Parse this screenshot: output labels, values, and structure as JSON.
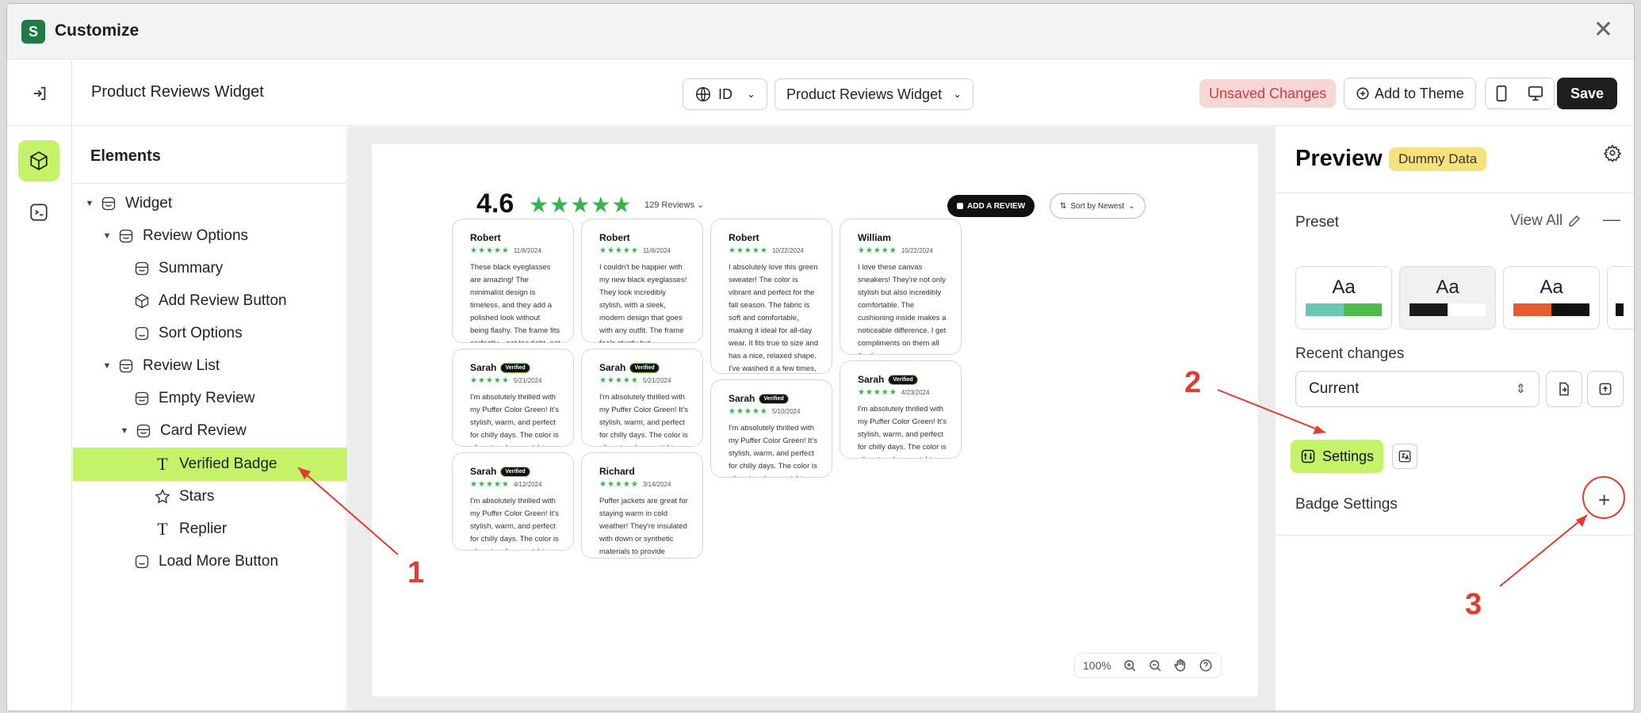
{
  "window": {
    "title": "Customize",
    "close_label": "✕"
  },
  "topbar": {
    "widget_name": "Product Reviews Widget",
    "language": "ID",
    "widget_select": "Product Reviews Widget",
    "unsaved": "Unsaved Changes",
    "add_to_theme": "Add to Theme",
    "save": "Save"
  },
  "elements_panel": {
    "title": "Elements",
    "items": [
      {
        "label": "Widget"
      },
      {
        "label": "Review Options"
      },
      {
        "label": "Summary"
      },
      {
        "label": "Add Review Button"
      },
      {
        "label": "Sort Options"
      },
      {
        "label": "Review List"
      },
      {
        "label": "Empty Review"
      },
      {
        "label": "Card Review"
      },
      {
        "label": "Verified Badge"
      },
      {
        "label": "Stars"
      },
      {
        "label": "Replier"
      },
      {
        "label": "Load More Button"
      }
    ]
  },
  "preview_widget": {
    "rating": "4.6",
    "stars": "★★★★★",
    "review_count": "129 Reviews",
    "add_review": "ADD A REVIEW",
    "sort": "Sort by Newest",
    "stars_small": "★★★★★",
    "verified": "Verified",
    "cards": [
      {
        "name": "Robert",
        "date": "11/8/2024",
        "text": "These black eyeglasses are amazing! The minimalist design is timeless, and they add a polished look without being flashy. The frame fits perfectly—not too tight, not too loose—and they're super comfortable, even after wearing them for hours. The qual..."
      },
      {
        "name": "Sarah",
        "date": "5/21/2024",
        "text": "I'm absolutely thrilled with my Puffer Color Green! It's stylish, warm, and perfect for chilly days. The color is vibrant and eye-catching. Highly recommend!"
      },
      {
        "name": "Sarah",
        "date": "4/12/2024",
        "text": "I'm absolutely thrilled with my Puffer Color Green! It's stylish, warm, and perfect for chilly days. The color is vibrant and eye-catching. Highly recommend!"
      },
      {
        "name": "Robert",
        "date": "11/8/2024",
        "text": "I couldn't be happier with my new black eyeglasses! They look incredibly stylish, with a sleek, modern design that goes with any outfit. The frame feels sturdy but lightweight, so they're comfortable to wear all day. The lenses offer clear vision wit..."
      },
      {
        "name": "Sarah",
        "date": "5/21/2024",
        "text": "I'm absolutely thrilled with my Puffer Color Green! It's stylish, warm, and perfect for chilly days. The color is vibrant and eye-catching. Highly recommend!"
      },
      {
        "name": "Richard",
        "date": "3/14/2024",
        "text": "Puffer jackets are great for staying warm in cold weather! They're insulated with down or synthetic materials to provide warmth and are often lightweight and comfortable to wear"
      },
      {
        "name": "Robert",
        "date": "10/22/2024",
        "text": "I absolutely love this green sweater! The color is vibrant and perfect for the fall season. The fabric is soft and comfortable, making it ideal for all-day wear. It fits true to size and has a nice, relaxed shape. I've washed it a few times, and it h..."
      },
      {
        "name": "Sarah",
        "date": "5/10/2024",
        "text": "I'm absolutely thrilled with my Puffer Color Green! It's stylish, warm, and perfect for chilly days. The color is vibrant and eye-catching. Highly recommend!"
      },
      {
        "name": "William",
        "date": "10/22/2024",
        "text": "I love these canvas sneakers! They're not only stylish but also incredibly comfortable. The cushioning inside makes a noticeable difference. I get compliments on them all the time."
      },
      {
        "name": "Sarah",
        "date": "4/23/2024",
        "text": "I'm absolutely thrilled with my Puffer Color Green! It's stylish, warm, and perfect for chilly days. The color is vibrant and eye-catching. Highly recommend!"
      }
    ]
  },
  "zoom": {
    "level": "100%"
  },
  "right_panel": {
    "title": "Preview",
    "badge": "Dummy Data",
    "preset_label": "Preset",
    "view_all": "View All",
    "preset_sample": "Aa",
    "recent_label": "Recent changes",
    "recent_value": "Current",
    "settings_tab": "Settings",
    "section_title": "Badge Settings",
    "add_label": "+"
  },
  "annotations": [
    "1",
    "2",
    "3"
  ],
  "colors": {
    "accent": "#c4f36a",
    "star": "#36b34a",
    "annotation": "#e23c2c"
  }
}
